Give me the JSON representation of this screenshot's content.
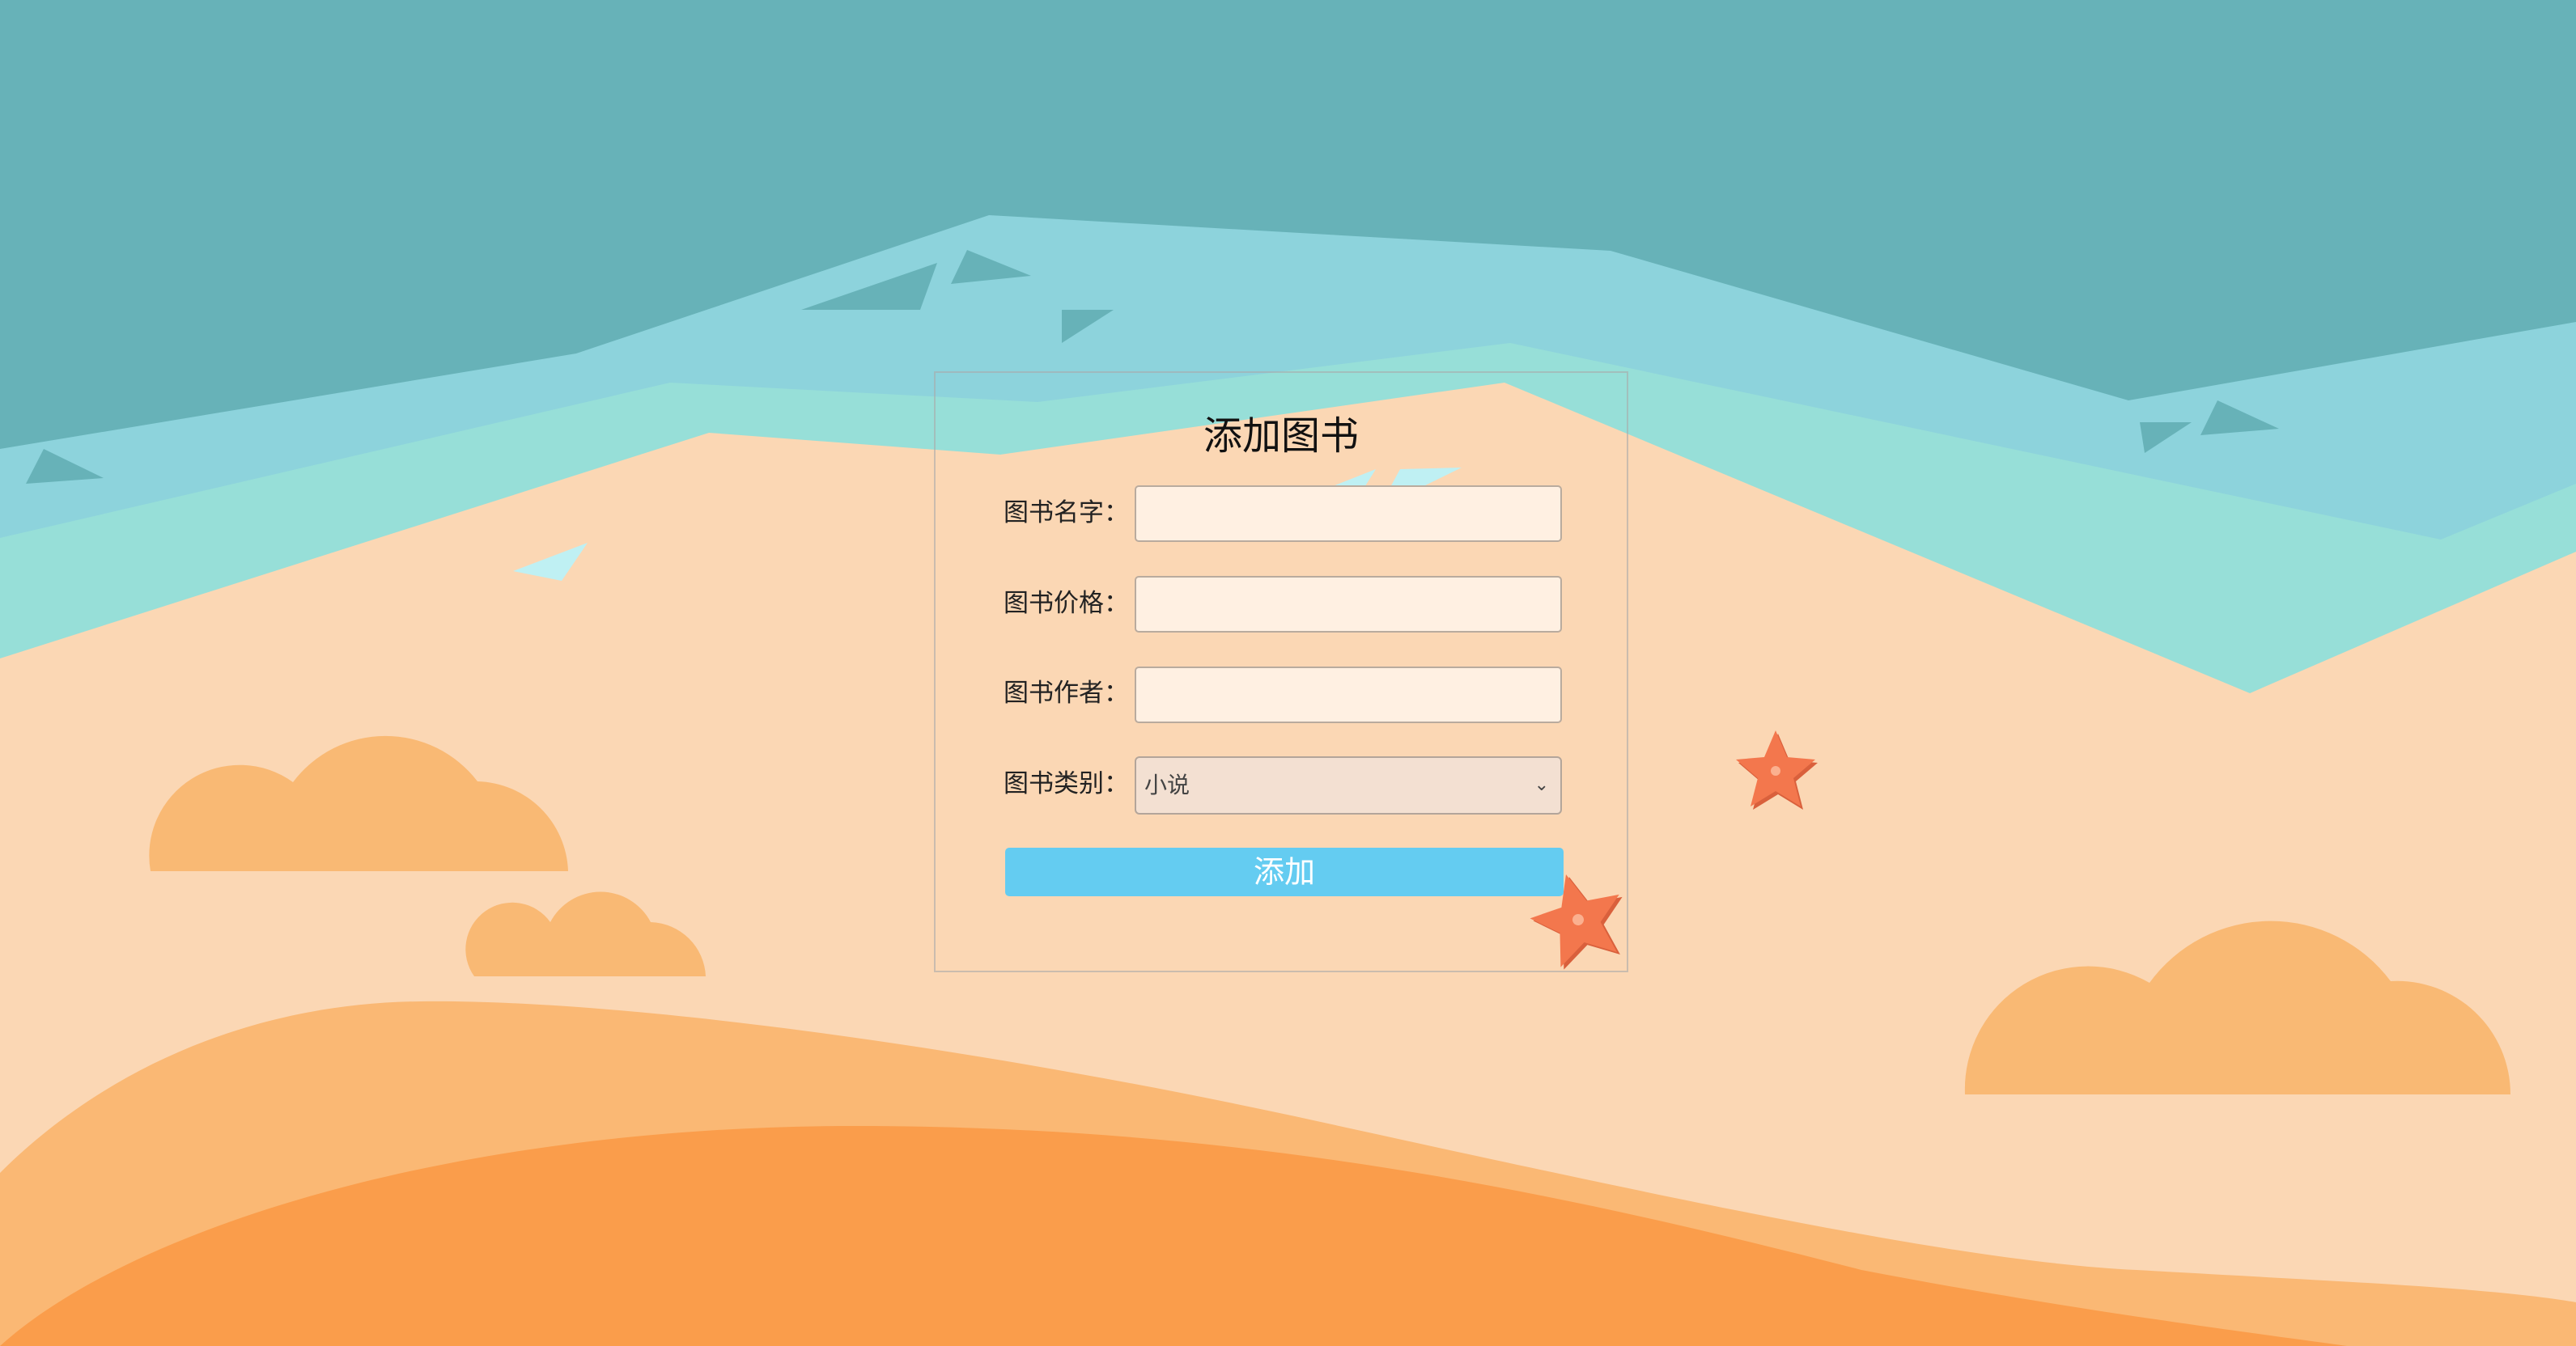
{
  "form": {
    "title": "添加图书",
    "fields": [
      {
        "label": "图书名字：",
        "value": "",
        "placeholder": ""
      },
      {
        "label": "图书价格：",
        "value": "",
        "placeholder": ""
      },
      {
        "label": "图书作者：",
        "value": "",
        "placeholder": ""
      }
    ],
    "category": {
      "label": "图书类别：",
      "selected": "小说"
    },
    "submit_label": "添加"
  },
  "colors": {
    "sky_teal": "#67b2b8",
    "water_light": "#8dd3dc",
    "shore_mint": "#97dfd8",
    "sand": "#fbd7b4",
    "dune_light": "#fab874",
    "dune_dark": "#fa9d4b",
    "cloud_orange": "#f9b974",
    "starfish": "#f3774d",
    "button_blue": "#64ccf1"
  }
}
